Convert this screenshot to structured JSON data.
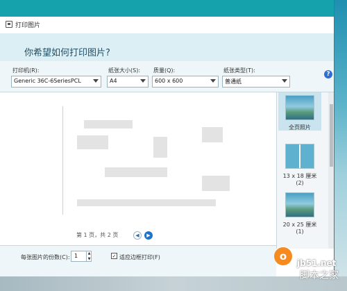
{
  "window": {
    "title": "打印图片"
  },
  "header": {
    "question": "你希望如何打印图片?"
  },
  "controls": {
    "printer": {
      "label": "打印机(R):",
      "value": "Generic 36C-6SeriesPCL"
    },
    "paper_size": {
      "label": "纸张大小(S):",
      "value": "A4"
    },
    "quality": {
      "label": "质量(Q):",
      "value": "600 x 600"
    },
    "paper_type": {
      "label": "纸张类型(T):",
      "value": "普通纸"
    }
  },
  "preview": {
    "pager_text": "第 1 页，共 2 页",
    "prev_icon": "◀",
    "next_icon": "▶"
  },
  "layouts": [
    {
      "label": "全页照片"
    },
    {
      "label": "13 x 18 厘米 (2)"
    },
    {
      "label": "20 x 25 厘米 (1)"
    }
  ],
  "bottom": {
    "copies_label": "每张图片的份数(C):",
    "copies_value": "1",
    "fit_label": "适应边框打印(F)",
    "fit_checked": "✓"
  },
  "watermark": {
    "logo": "o",
    "site": "jb51.net",
    "name": "脚本之家"
  },
  "icons": {
    "help": "?",
    "title": "printer-icon"
  }
}
